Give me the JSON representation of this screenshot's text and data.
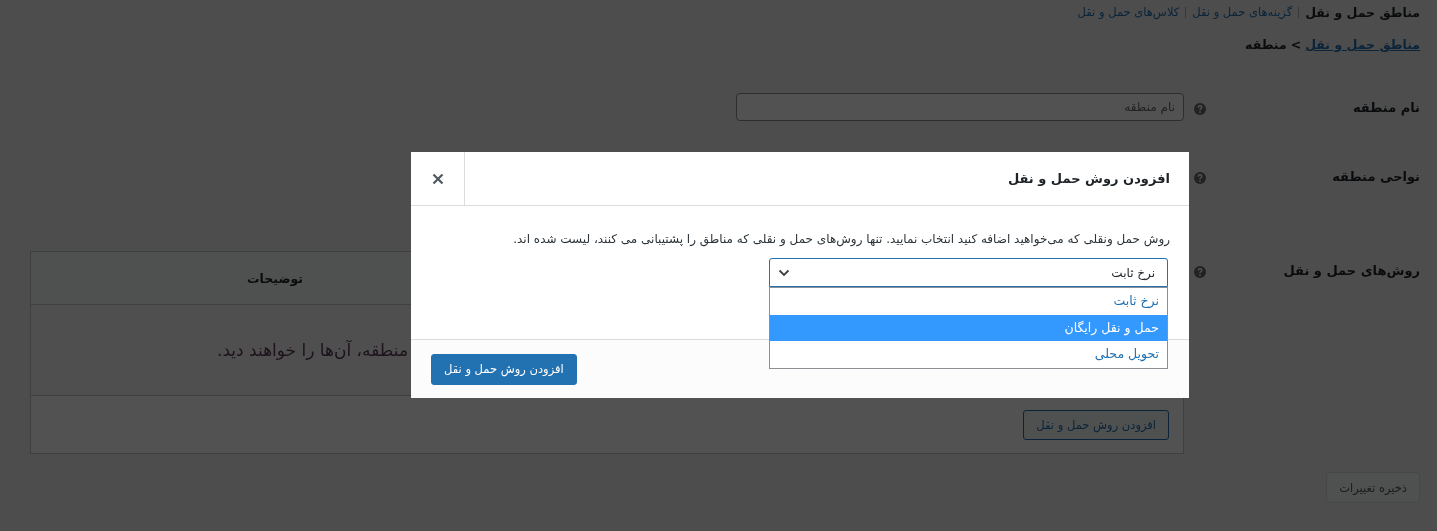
{
  "nav": {
    "items": [
      {
        "label": "مناطق حمل و نقل",
        "selected": true
      },
      {
        "label": "گزینه‌های حمل و نقل",
        "selected": false
      },
      {
        "label": "کلاس‌های حمل و نقل",
        "selected": false
      }
    ]
  },
  "breadcrumb": {
    "link": "مناطق حمل و نقل",
    "separator": ">",
    "current": "منطقه"
  },
  "form": {
    "rows": [
      {
        "kind": "text",
        "label": "نام منطقه",
        "placeholder": "نام منطقه"
      },
      {
        "kind": "blank",
        "label": "نواحی منطقه"
      },
      {
        "kind": "table",
        "label": "روش‌های حمل و نقل"
      }
    ]
  },
  "methods_table": {
    "columns": [
      "توضیحات"
    ],
    "empty_message": "منطقه، آن‌ها را خواهند دید.",
    "add_button": "افزودن روش حمل و نقل"
  },
  "save_button": {
    "label": "ذخیره تغییرات",
    "disabled": true
  },
  "modal": {
    "title": "افزودن روش حمل و نقل",
    "description": "روش حمل ونقلی که می‌خواهید اضافه کنید انتخاب نمایید. تنها روش‌های حمل و نقلی که مناطق را پشتیبانی می کنند، لیست شده اند.",
    "select": {
      "value": "نرخ ثابت",
      "expanded": true,
      "options": [
        {
          "label": "نرخ ثابت",
          "highlighted": false
        },
        {
          "label": "حمل و نقل رایگان",
          "highlighted": true
        },
        {
          "label": "تحویل محلی",
          "highlighted": false
        }
      ]
    },
    "submit": "افزودن روش حمل و نقل"
  }
}
